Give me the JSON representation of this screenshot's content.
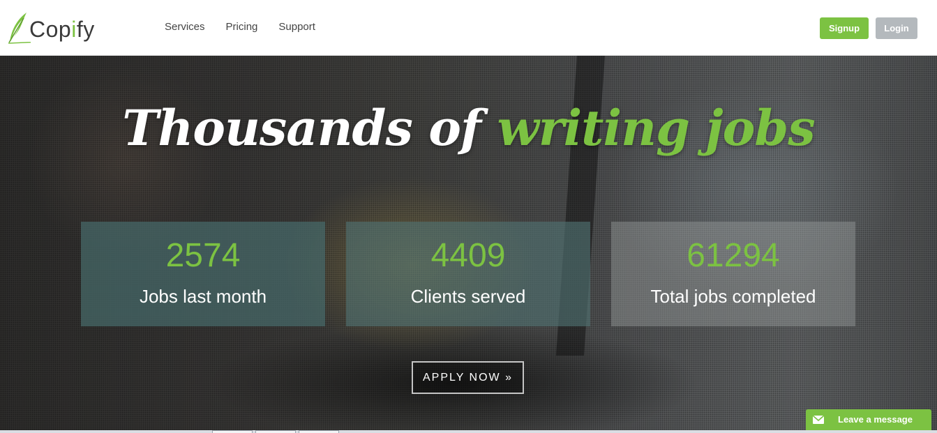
{
  "header": {
    "logo": {
      "text_before": "Cop",
      "text_accent": "i",
      "text_after": "fy",
      "icon": "feather-leaf-icon"
    },
    "nav": [
      {
        "label": "Services"
      },
      {
        "label": "Pricing"
      },
      {
        "label": "Support"
      }
    ],
    "signup_label": "Signup",
    "login_label": "Login"
  },
  "hero": {
    "title_white": "Thousands of",
    "title_green": "writing jobs",
    "stats": [
      {
        "number": "2574",
        "label": "Jobs last month"
      },
      {
        "number": "4409",
        "label": "Clients served"
      },
      {
        "number": "61294",
        "label": "Total jobs completed"
      }
    ],
    "apply_label": "APPLY NOW »"
  },
  "chat": {
    "label": "Leave a message",
    "icon": "envelope-icon"
  },
  "colors": {
    "brand_green": "#7cc242",
    "login_gray": "#b4b9bd",
    "text_dark": "#3a3a3a"
  }
}
